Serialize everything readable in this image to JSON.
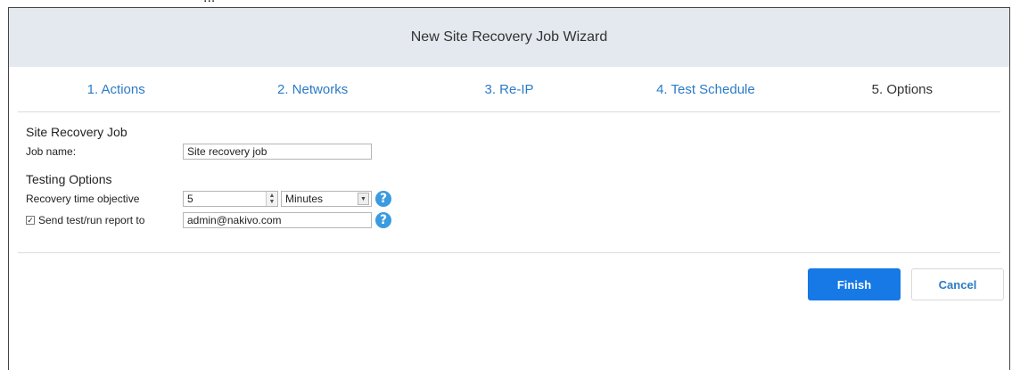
{
  "doc_text_above": "...",
  "wizard": {
    "title": "New Site Recovery Job Wizard",
    "steps": [
      {
        "label": "1. Actions"
      },
      {
        "label": "2. Networks"
      },
      {
        "label": "3. Re-IP"
      },
      {
        "label": "4. Test Schedule"
      },
      {
        "label": "5. Options"
      }
    ],
    "current_step": 5
  },
  "job": {
    "section_title": "Site Recovery Job",
    "job_name_label": "Job name:",
    "job_name_value": "Site recovery job"
  },
  "testing": {
    "section_title": "Testing Options",
    "rto_label": "Recovery time objective",
    "rto_value": "5",
    "rto_unit": "Minutes",
    "report_label": "Send test/run report to",
    "report_checked": true,
    "report_email": "admin@nakivo.com"
  },
  "icons": {
    "help": "question-circle-icon",
    "spinner": "spinner-arrows-icon",
    "dropdown": "chevron-down-icon",
    "check": "checkmark-icon"
  },
  "colors": {
    "accent": "#1679e5",
    "link": "#2b7bc6",
    "header_bg": "#e4e8ef",
    "help_icon": "#3a9be0"
  },
  "buttons": {
    "finish": "Finish",
    "cancel": "Cancel"
  }
}
